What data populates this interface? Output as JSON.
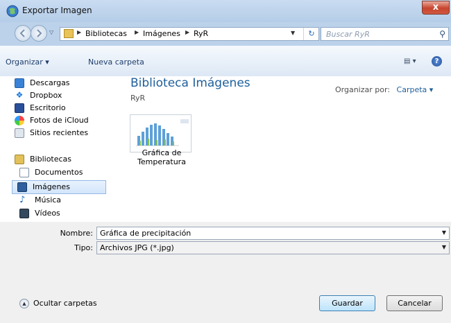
{
  "window": {
    "title": "Exportar Imagen",
    "close_glyph": "x"
  },
  "address": {
    "breadcrumbs": [
      "Bibliotecas",
      "Imágenes",
      "RyR"
    ],
    "search_placeholder": "Buscar RyR"
  },
  "toolbar": {
    "organize_label": "Organizar ▾",
    "new_folder_label": "Nueva carpeta",
    "help_glyph": "?"
  },
  "nav_pane": {
    "items": [
      {
        "label": "Descargas",
        "icon": "downloads-icon"
      },
      {
        "label": "Dropbox",
        "icon": "dropbox-icon"
      },
      {
        "label": "Escritorio",
        "icon": "desktop-icon"
      },
      {
        "label": "Fotos de iCloud",
        "icon": "icloud-photos-icon"
      },
      {
        "label": "Sitios recientes",
        "icon": "recent-places-icon"
      },
      {
        "label": "Bibliotecas",
        "icon": "libraries-icon"
      },
      {
        "label": "Documentos",
        "icon": "documents-icon"
      },
      {
        "label": "Imágenes",
        "icon": "pictures-icon",
        "selected": true
      },
      {
        "label": "Música",
        "icon": "music-icon"
      },
      {
        "label": "Vídeos",
        "icon": "videos-icon"
      }
    ]
  },
  "library": {
    "title": "Biblioteca Imágenes",
    "subtitle": "RyR",
    "arrange_label": "Organizar por:",
    "arrange_value": "Carpeta"
  },
  "files": [
    {
      "name_line1": "Gráfica de",
      "name_line2": "Temperatura"
    }
  ],
  "save_form": {
    "filename_label": "Nombre:",
    "filename_value": "Gráfica de precipitación",
    "type_label": "Tipo:",
    "type_value": "Archivos JPG (*.jpg)"
  },
  "footer": {
    "hide_folders_label": "Ocultar carpetas",
    "save_label": "Guardar",
    "cancel_label": "Cancelar"
  },
  "colors": {
    "title_bar": "#c9dcf1",
    "close_button": "#c7452e",
    "library_title": "#1e5f9b",
    "selection": "#d3e5fb"
  }
}
